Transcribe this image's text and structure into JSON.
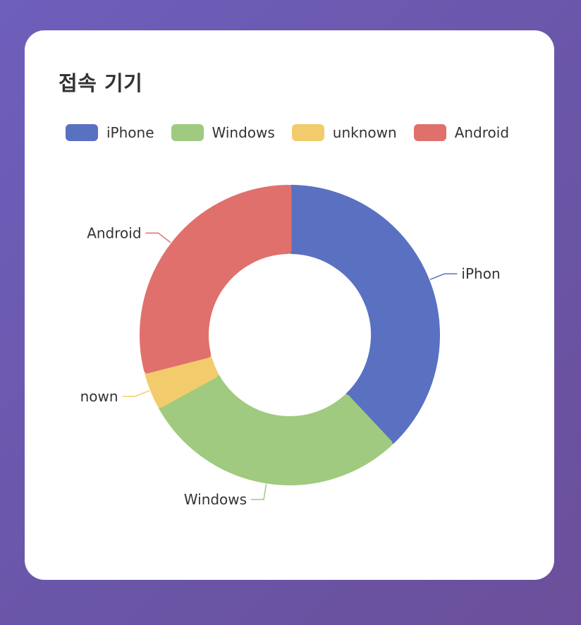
{
  "card": {
    "title": "접속 기기"
  },
  "legend": {
    "items": [
      {
        "label": "iPhone",
        "color": "#5a70c1"
      },
      {
        "label": "Windows",
        "color": "#9fca7f"
      },
      {
        "label": "unknown",
        "color": "#f2cc6c"
      },
      {
        "label": "Android",
        "color": "#e0706c"
      }
    ]
  },
  "chart_data": {
    "type": "pie",
    "variant": "donut",
    "legend_position": "top",
    "title": "접속 기기",
    "categories": [
      "iPhone",
      "Windows",
      "unknown",
      "Android"
    ],
    "values": [
      38,
      29,
      4,
      29
    ],
    "colors": [
      "#5a70c1",
      "#9fca7f",
      "#f2cc6c",
      "#e0706c"
    ],
    "labels": [
      {
        "name": "iPhone",
        "text": "iPhon"
      },
      {
        "name": "Windows",
        "text": "Windows"
      },
      {
        "name": "unknown",
        "text": "nown"
      },
      {
        "name": "Android",
        "text": "Android"
      }
    ]
  }
}
